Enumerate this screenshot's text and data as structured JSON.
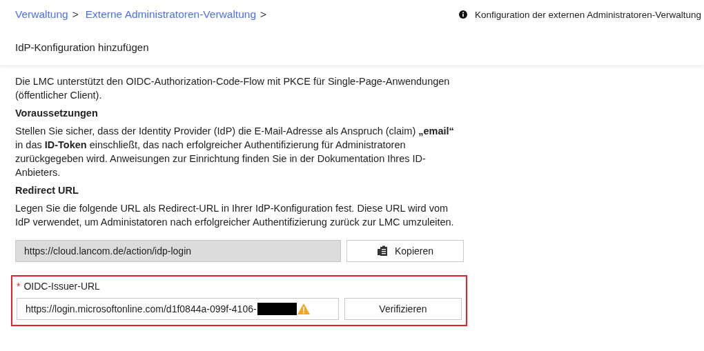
{
  "breadcrumb": [
    {
      "label": "Verwaltung",
      "separator": ">"
    },
    {
      "label": "Externe Administratoren-Verwaltung",
      "separator": ">"
    }
  ],
  "info_link": {
    "label": "Konfiguration der externen Administratoren-Verwaltung"
  },
  "page_title": "IdP-Konfiguration hinzufügen",
  "blocks": [
    {
      "kind": "paragraph",
      "text": "Die LMC unterstützt den OIDC-Authorization-Code-Flow mit PKCE für Single-Page-Anwendungen (öffentlicher Client)."
    },
    {
      "kind": "heading",
      "text": "Voraussetzungen"
    },
    {
      "kind": "paragraph",
      "text": "Stellen Sie sicher, dass der Identity Provider (IdP) die E-Mail-Adresse als Anspruch (claim) **„email“** in das **ID-Token** einschließt, das nach erfolgreicher Authentifizierung für Administratoren zurückgegeben wird. Anweisungen zur Einrichtung finden Sie in der Dokumentation Ihres ID-Anbieters."
    },
    {
      "kind": "heading",
      "text": "Redirect URL"
    },
    {
      "kind": "paragraph",
      "text": "Legen Sie die folgende URL als Redirect-URL in Ihrer IdP-Konfiguration fest. Diese URL wird vom IdP verwendet, um Administatoren nach erfolgreicher Authentifizierung zurück zur LMC umzuleiten."
    }
  ],
  "redirect_field": {
    "value": "https://cloud.lancom.de/action/idp-login",
    "disabled": true,
    "button": "Kopieren"
  },
  "issuer_field": {
    "required_mark": "*",
    "label": "OIDC-Issuer-URL",
    "value": "https://login.microsoftonline.com/d1f0844a-099f-4106-",
    "redacted": true,
    "warning": true,
    "highlighted": true,
    "button": "Verifizieren"
  }
}
